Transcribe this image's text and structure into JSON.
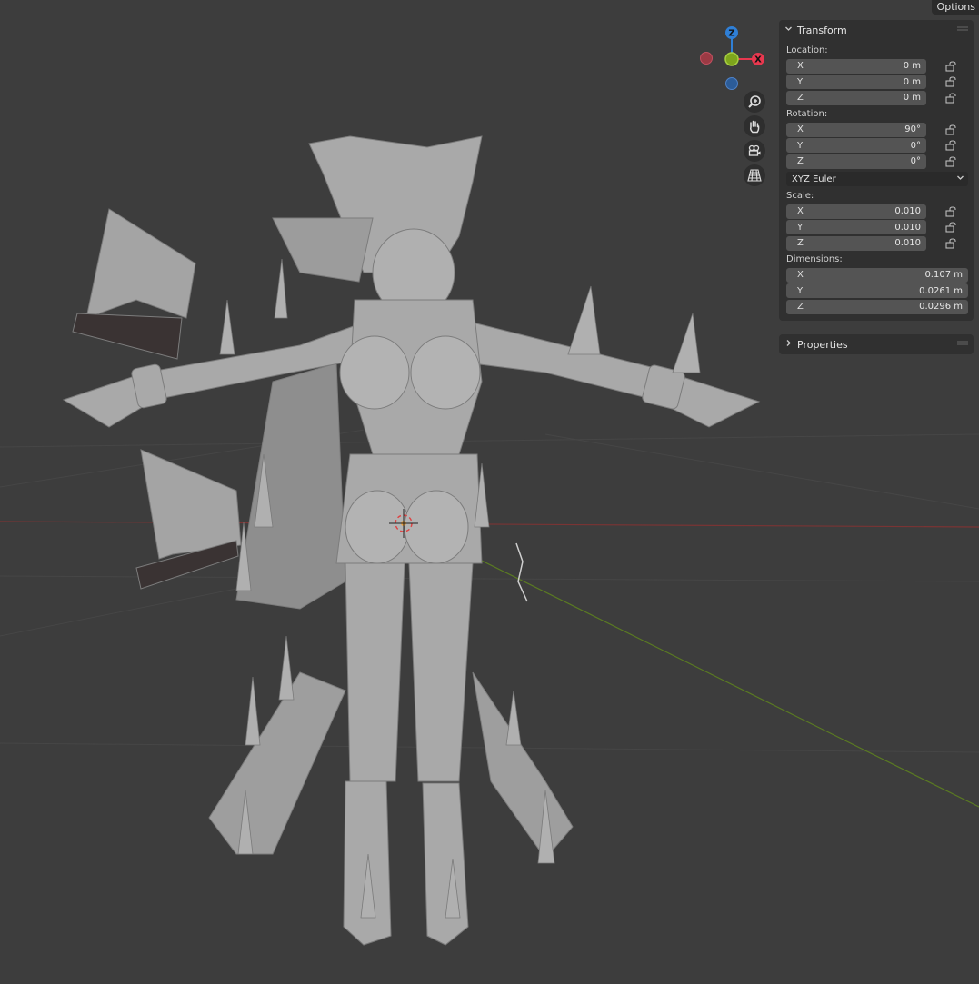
{
  "header": {
    "options_label": "Options"
  },
  "gizmo": {
    "axis_z": "Z",
    "axis_x": "X",
    "colors": {
      "x": "#e8384f",
      "y": "#7ea51c",
      "z": "#2f7fd6",
      "neg_x": "#9b3a44",
      "neg_z": "#2c5c98"
    }
  },
  "nav_tools": [
    "zoom-icon",
    "hand-pan-icon",
    "camera-icon",
    "perspective-grid-icon"
  ],
  "transform": {
    "title": "Transform",
    "location_label": "Location:",
    "location": [
      {
        "axis": "X",
        "value": "0 m"
      },
      {
        "axis": "Y",
        "value": "0 m"
      },
      {
        "axis": "Z",
        "value": "0 m"
      }
    ],
    "rotation_label": "Rotation:",
    "rotation": [
      {
        "axis": "X",
        "value": "90°"
      },
      {
        "axis": "Y",
        "value": "0°"
      },
      {
        "axis": "Z",
        "value": "0°"
      }
    ],
    "rotation_mode": "XYZ Euler",
    "scale_label": "Scale:",
    "scale": [
      {
        "axis": "X",
        "value": "0.010"
      },
      {
        "axis": "Y",
        "value": "0.010"
      },
      {
        "axis": "Z",
        "value": "0.010"
      }
    ],
    "dimensions_label": "Dimensions:",
    "dimensions": [
      {
        "axis": "X",
        "value": "0.107 m"
      },
      {
        "axis": "Y",
        "value": "0.0261 m"
      },
      {
        "axis": "Z",
        "value": "0.0296 m"
      }
    ]
  },
  "properties": {
    "title": "Properties"
  },
  "colors": {
    "background": "#3d3d3d",
    "panel": "#303030",
    "field": "#545454",
    "x_axis_line": "#8a3a3a",
    "y_axis_line": "#5d7d20"
  }
}
